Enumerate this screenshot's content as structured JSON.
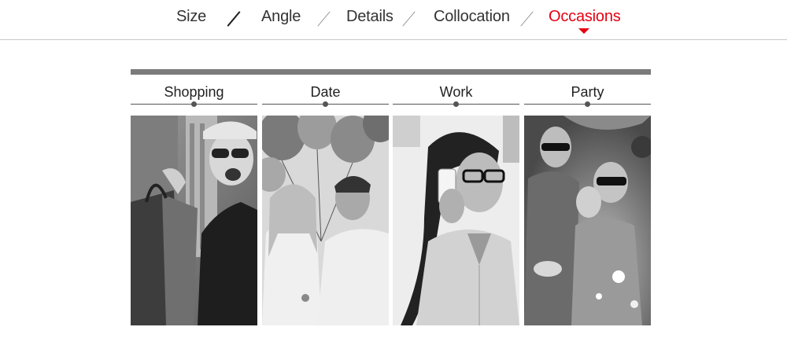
{
  "nav": {
    "items": [
      {
        "label": "Size"
      },
      {
        "label": "Angle"
      },
      {
        "label": "Details"
      },
      {
        "label": "Collocation"
      },
      {
        "label": "Occasions"
      }
    ],
    "active_index": 4,
    "active_color": "#e60012"
  },
  "occasions": {
    "items": [
      {
        "label": "Shopping",
        "image": "woman-with-shopping-bags-photo"
      },
      {
        "label": "Date",
        "image": "couple-with-balloons-photo"
      },
      {
        "label": "Work",
        "image": "woman-on-phone-with-glasses-photo"
      },
      {
        "label": "Party",
        "image": "people-partying-photo"
      }
    ]
  }
}
